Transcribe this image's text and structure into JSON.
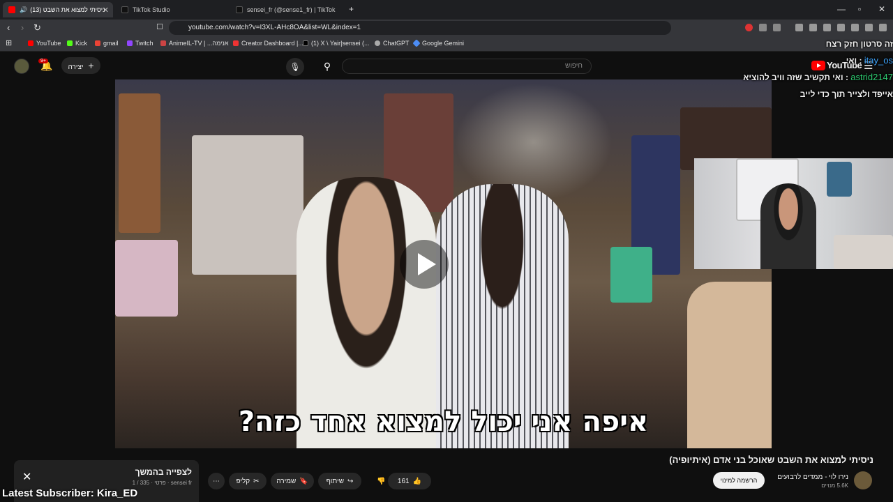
{
  "browser": {
    "tabs": [
      {
        "label": "(13) ניסיתי למצוא את השבט",
        "active": true
      },
      {
        "label": "TikTok Studio",
        "active": false
      },
      {
        "label": "sensei_fr (@sense1_fr) | TikTok",
        "active": false
      }
    ],
    "url": "youtube.com/watch?v=I3XL-AHc8OA&list=WL&index=1",
    "bookmarks": [
      "YouTube",
      "Kick",
      "gmail",
      "Twitch",
      "AnimeIL-TV | ...אנימה",
      "Creator Dashboard |...",
      "(1) X \\ Yair|sensei (...",
      "ChatGPT",
      "Google Gemini"
    ]
  },
  "youtube": {
    "logo_text": "YouTube",
    "search_placeholder": "חיפוש",
    "create_label": "יצירה",
    "notification_count": "9+"
  },
  "chat": [
    {
      "user": "",
      "message": "זה סרטון חזק רצח"
    },
    {
      "user": "itay_os",
      "message": "ואי"
    },
    {
      "user": "astrid2147",
      "message": "ואי תקשיב שזה וויב להוציא"
    },
    {
      "user": "",
      "message": "אייפד ולצייר תוך כדי לייב"
    }
  ],
  "video": {
    "subtitle": "איפה אני יכול למצוא אחד כזה?",
    "title": "ניסיתי למצוא את השבט שאוכל בני אדם (איתיופיה)"
  },
  "channel": {
    "name": "נירו לוי - ממדים לרבועים",
    "subscribers": "5.6K מנויים",
    "subscribe_label": "הרשמה למינוי"
  },
  "actions": {
    "likes": "161",
    "share_label": "שיתוף",
    "save_label": "שמירה",
    "clip_label": "קליפ"
  },
  "playlist": {
    "title": "לצפייה בהמשך",
    "subtitle": "sensei fr · פרטי · 335 / 1"
  },
  "overlay": {
    "latest_subscriber": "Latest Subscriber: Kira_ED"
  },
  "colors": {
    "accent": "#ff0000",
    "link": "#3ea6ff",
    "chat_green": "#2ecc71"
  }
}
